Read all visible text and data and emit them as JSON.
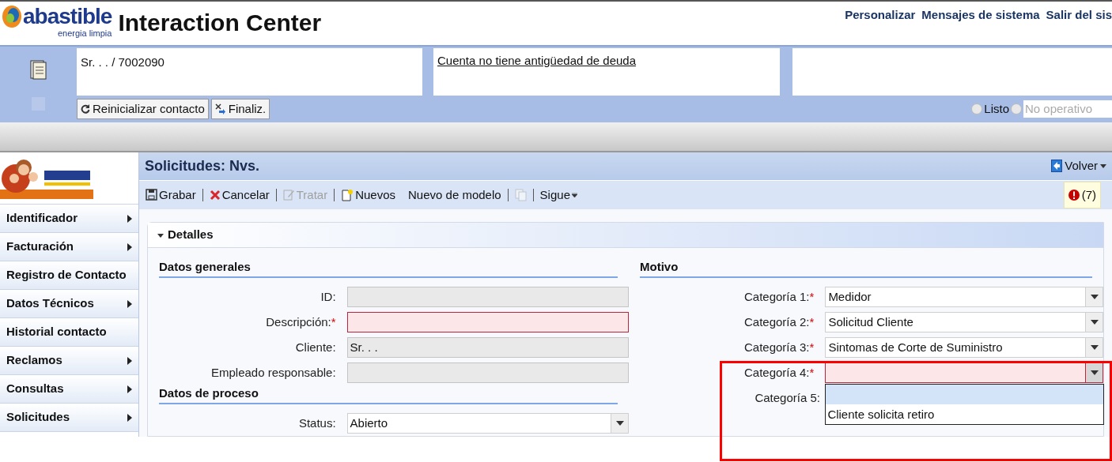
{
  "header": {
    "logo_name": "abastible",
    "logo_tagline": "energia limpia",
    "title": "Interaction Center",
    "links": [
      "Personalizar",
      "Mensajes de sistema",
      "Salir del sis"
    ]
  },
  "contact_bar": {
    "contact": "Sr. . . / 7002090",
    "alert": "Cuenta no tiene antigüedad de deuda",
    "buttons": [
      {
        "label": "Reinicializar contacto",
        "kind": "refresh"
      },
      {
        "label": "Finaliz.",
        "kind": "end"
      }
    ],
    "status_options": [
      {
        "label": "Listo",
        "selected": false,
        "disabled": false
      },
      {
        "label": "No operativo",
        "selected": false,
        "disabled": true
      }
    ]
  },
  "sidebar": {
    "items": [
      {
        "label": "Identificador",
        "has_submenu": true
      },
      {
        "label": "Facturación",
        "has_submenu": true
      },
      {
        "label": "Registro de Contacto",
        "has_submenu": false
      },
      {
        "label": "Datos Técnicos",
        "has_submenu": true
      },
      {
        "label": "Historial contacto",
        "has_submenu": false
      },
      {
        "label": "Reclamos",
        "has_submenu": true
      },
      {
        "label": "Consultas",
        "has_submenu": true
      },
      {
        "label": "Solicitudes",
        "has_submenu": true
      }
    ]
  },
  "page": {
    "title": "Solicitudes: Nvs.",
    "back": "Volver",
    "messages": "(7)",
    "toolbar": [
      {
        "label": "Grabar",
        "kind": "save",
        "disabled": false
      },
      {
        "label": "Cancelar",
        "kind": "cancel",
        "disabled": false
      },
      {
        "label": "Tratar",
        "kind": "edit",
        "disabled": true
      },
      {
        "label": "Nuevos",
        "kind": "new",
        "disabled": false
      },
      {
        "label": "Nuevo de modelo",
        "kind": "text",
        "disabled": false
      },
      {
        "kind": "copy",
        "disabled": true
      },
      {
        "label": "Sigue",
        "kind": "more",
        "disabled": false
      }
    ],
    "section": "Detalles",
    "expanded": true,
    "left_groups": [
      {
        "title": "Datos generales",
        "fields": [
          {
            "label": "ID:",
            "kind": "text",
            "error": false,
            "readonly": true
          },
          {
            "label": "Descripción:",
            "required_mark": "*",
            "kind": "text",
            "error": true,
            "readonly": false
          },
          {
            "label": "Cliente:",
            "kind": "text",
            "error": false,
            "value": "Sr. . .",
            "readonly": true
          },
          {
            "label": "Empleado responsable:",
            "kind": "text",
            "error": false,
            "readonly": true
          }
        ]
      },
      {
        "title": "Datos de proceso",
        "fields": [
          {
            "label": "Status:",
            "kind": "select",
            "error": false,
            "value": "Abierto"
          }
        ]
      }
    ],
    "right_groups": [
      {
        "title": "Motivo",
        "fields": [
          {
            "label": "Categoría 1:",
            "required_mark": "*",
            "kind": "select",
            "error": false,
            "value": "Medidor"
          },
          {
            "label": "Categoría 2:",
            "required_mark": "*",
            "kind": "select",
            "error": false,
            "value": "Solicitud Cliente"
          },
          {
            "label": "Categoría 3:",
            "required_mark": "*",
            "kind": "select",
            "error": false,
            "value": "Sintomas de Corte de Suministro"
          },
          {
            "label": "Categoría 4:",
            "required_mark": "*",
            "kind": "select",
            "error": true,
            "open": true
          },
          {
            "label": "Categoría 5:"
          }
        ]
      }
    ],
    "dropdown": {
      "blank_selected": true,
      "options": [
        {
          "label": "Cliente solicita retiro",
          "selected": false
        }
      ]
    }
  },
  "highlight": {
    "visible": true
  }
}
